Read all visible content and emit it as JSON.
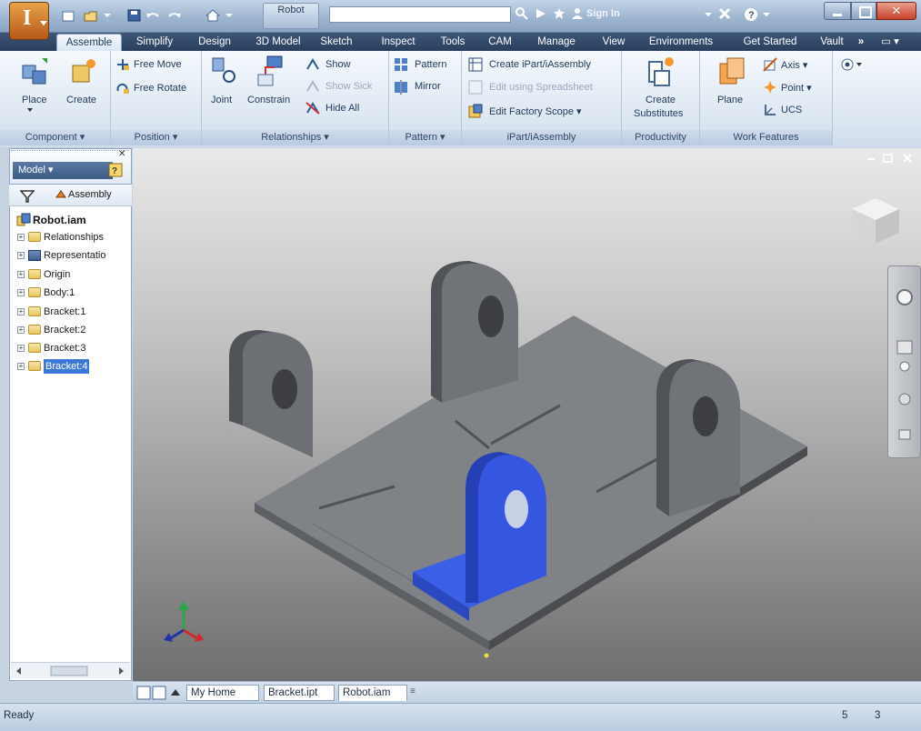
{
  "app": {
    "logo_letter": "I",
    "doc_title": "Robot",
    "signin": "Sign In",
    "window_buttons": [
      "minimize",
      "maximize",
      "close"
    ]
  },
  "qat_icons": [
    "new-icon",
    "open-icon",
    "save-icon",
    "undo-icon",
    "redo-icon",
    "home-icon"
  ],
  "title_icons": [
    "search-icon",
    "exchange-icon",
    "star-icon",
    "user-icon",
    "help-icon"
  ],
  "tabs": [
    {
      "label": "Assemble",
      "active": true
    },
    {
      "label": "Simplify"
    },
    {
      "label": "Design"
    },
    {
      "label": "3D Model"
    },
    {
      "label": "Sketch"
    },
    {
      "label": "Inspect"
    },
    {
      "label": "Tools"
    },
    {
      "label": "CAM"
    },
    {
      "label": "Manage"
    },
    {
      "label": "View"
    },
    {
      "label": "Environments"
    },
    {
      "label": "Get Started"
    },
    {
      "label": "Vault"
    }
  ],
  "ribbon": {
    "component": {
      "title": "Component ▾",
      "place": "Place",
      "create": "Create"
    },
    "position": {
      "title": "Position ▾",
      "free_move": "Free Move",
      "free_rotate": "Free Rotate"
    },
    "relationships": {
      "title": "Relationships ▾",
      "joint": "Joint",
      "constrain": "Constrain",
      "show": "Show",
      "show_sick": "Show Sick",
      "hide_all": "Hide All"
    },
    "pattern": {
      "title": "Pattern ▾",
      "pattern": "Pattern",
      "mirror": "Mirror"
    },
    "ipart": {
      "title": "iPart/iAssembly",
      "create": "Create iPart/iAssembly",
      "edit_spreadsheet": "Edit using Spreadsheet",
      "edit_factory": "Edit Factory Scope ▾"
    },
    "productivity": {
      "title": "Productivity",
      "create_sub_1": "Create",
      "create_sub_2": "Substitutes"
    },
    "work_features": {
      "title": "Work Features",
      "plane": "Plane",
      "axis": "Axis ▾",
      "point": "Point ▾",
      "ucs": "UCS"
    }
  },
  "browser": {
    "model_label": "Model ▾",
    "filter_label": "Assembly",
    "root": "Robot.iam",
    "items": [
      {
        "label": "Relationships",
        "type": "folder"
      },
      {
        "label": "Representatio",
        "type": "rep"
      },
      {
        "label": "Origin",
        "type": "folder"
      },
      {
        "label": "Body:1",
        "type": "part"
      },
      {
        "label": "Bracket:1",
        "type": "part"
      },
      {
        "label": "Bracket:2",
        "type": "part"
      },
      {
        "label": "Bracket:3",
        "type": "part"
      },
      {
        "label": "Bracket:4",
        "type": "part",
        "selected": true
      }
    ]
  },
  "doc_tabs": [
    "My Home",
    "Bracket.ipt",
    "Robot.iam"
  ],
  "status": {
    "text": "Ready",
    "num1": "5",
    "num2": "3"
  },
  "colors": {
    "selected_part": "#2f4fe0",
    "part_gray": "#7c7f84",
    "ribbon_dark": "#2a3f5e"
  }
}
